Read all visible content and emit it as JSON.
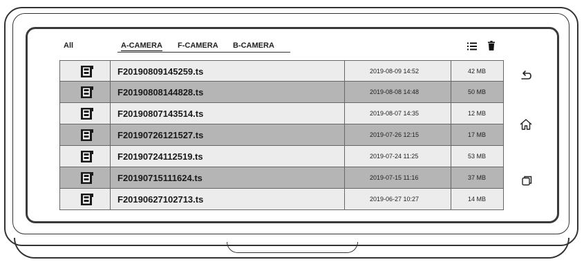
{
  "tabs": {
    "all": "All",
    "cameras": [
      "A-CAMERA",
      "F-CAMERA",
      "B-CAMERA"
    ],
    "active": "A-CAMERA"
  },
  "toolbar_icons": [
    "list-icon",
    "trash-icon"
  ],
  "files": [
    {
      "name": "F20190809145259.ts",
      "date": "2019-08-09 14:52",
      "size": "42 MB"
    },
    {
      "name": "F20190808144828.ts",
      "date": "2019-08-08 14:48",
      "size": "50 MB"
    },
    {
      "name": "F20190807143514.ts",
      "date": "2019-08-07 14:35",
      "size": "12 MB"
    },
    {
      "name": "F20190726121527.ts",
      "date": "2019-07-26 12:15",
      "size": "17 MB"
    },
    {
      "name": "F20190724112519.ts",
      "date": "2019-07-24 11:25",
      "size": "53 MB"
    },
    {
      "name": "F20190715111624.ts",
      "date": "2019-07-15 11:16",
      "size": "37 MB"
    },
    {
      "name": "F20190627102713.ts",
      "date": "2019-06-27 10:27",
      "size": "14 MB"
    }
  ],
  "side_nav": [
    "back-icon",
    "home-icon",
    "recent-apps-icon"
  ],
  "colors": {
    "row_light": "#ececec",
    "row_dark": "#b5b5b5",
    "line": "#333333"
  }
}
